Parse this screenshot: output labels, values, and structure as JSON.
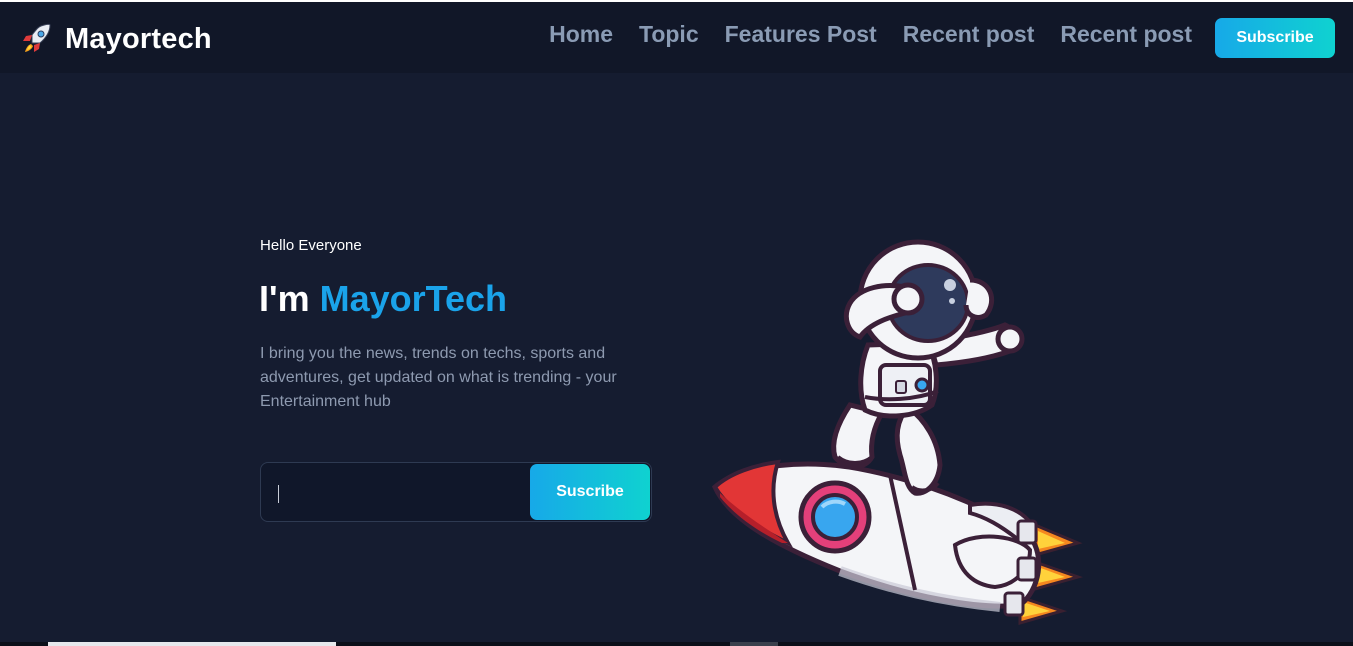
{
  "header": {
    "logo_icon": "rocket-icon",
    "title": "Mayortech",
    "nav": [
      "Home",
      "Topic",
      "Features Post",
      "Recent post",
      "Recent post"
    ],
    "subscribe_label": "Subscribe"
  },
  "hero": {
    "greeting": "Hello Everyone",
    "title_prefix": "I'm",
    "title_accent": "MayorTech",
    "description": "I bring you the news, trends on techs, sports and adventures, get updated on what is trending - your Entertainment hub",
    "email_value": "",
    "submit_label": "Suscribe",
    "illustration": "astronaut-on-rocket-illustration"
  },
  "colors": {
    "background": "#151c30",
    "header_background": "#111728",
    "accent": "#1aa3ea",
    "button_gradient_start": "#17a9e8",
    "button_gradient_end": "#0fd2d0",
    "nav_text": "#8a9bb4"
  }
}
